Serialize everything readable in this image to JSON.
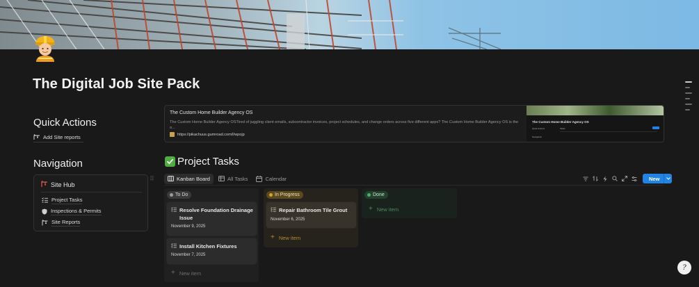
{
  "page": {
    "title": "The Digital Job Site Pack",
    "icon": "construction-worker-icon"
  },
  "quick_actions": {
    "heading": "Quick Actions",
    "add_button_label": "Add Site reports"
  },
  "navigation": {
    "heading": "Navigation",
    "hub_title": "Site Hub",
    "links": [
      {
        "label": "Project Tasks",
        "icon": "checklist-icon"
      },
      {
        "label": "Inspections & Permits",
        "icon": "shield-icon"
      },
      {
        "label": "Site Reports",
        "icon": "crane-icon"
      }
    ]
  },
  "bookmark": {
    "title": "The Custom Home Builder Agency OS",
    "description": "The Custom Home Builder Agency OSTired of juggling client emails, subcontractor invoices, project schedules, and change orders across five different apps? The Custom Home Builder Agency OS is the o...",
    "url": "https://pikachuus.gumroad.com/l/wpojp",
    "thumb_title": "The Custom Home Builder Agency OS",
    "thumb_quick": "Quick Actions",
    "thumb_nav": "Navigation",
    "thumb_tasks": "Tasks"
  },
  "database": {
    "title": "Project Tasks",
    "views": [
      {
        "label": "Kanban Board",
        "active": true
      },
      {
        "label": "All Tasks",
        "active": false
      },
      {
        "label": "Calendar",
        "active": false
      }
    ],
    "new_button_label": "New",
    "columns": [
      {
        "status": "To Do",
        "cards": [
          {
            "title": "Resolve Foundation Drainage Issue",
            "date": "November 9, 2025"
          },
          {
            "title": "Install Kitchen Fixtures",
            "date": "November 7, 2025"
          }
        ],
        "new_item_label": "New item"
      },
      {
        "status": "In Progress",
        "cards": [
          {
            "title": "Repair Bathroom Tile Grout",
            "date": "November 6, 2025"
          }
        ],
        "new_item_label": "New item"
      },
      {
        "status": "Done",
        "cards": [],
        "new_item_label": "New item"
      }
    ]
  },
  "help": {
    "label": "?"
  },
  "colors": {
    "background": "#191919",
    "accent": "#2383e2",
    "status_todo": "#9a9a9a",
    "status_in_progress": "#d8a12b",
    "status_done": "#4dab6b"
  }
}
